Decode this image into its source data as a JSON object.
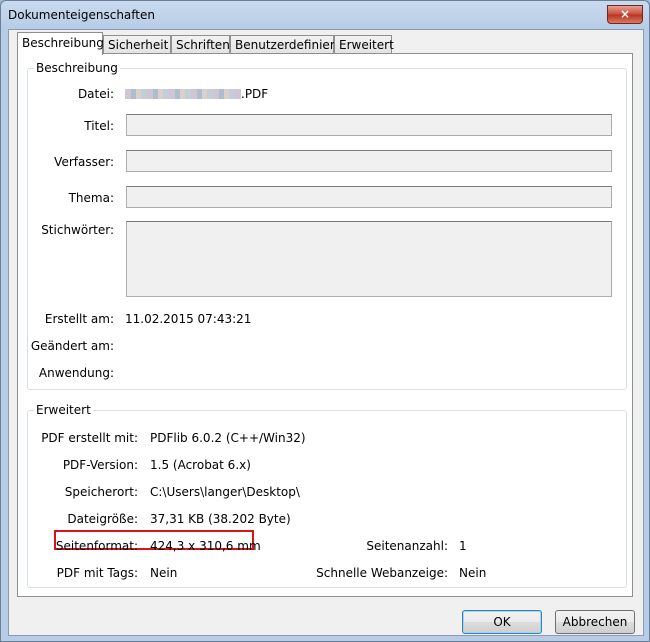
{
  "window": {
    "title": "Dokumenteigenschaften",
    "close_glyph": "×"
  },
  "tabs": [
    {
      "label": "Beschreibung"
    },
    {
      "label": "Sicherheit"
    },
    {
      "label": "Schriften"
    },
    {
      "label": "Benutzerdefiniert"
    },
    {
      "label": "Erweitert"
    }
  ],
  "beschreibung": {
    "group_title": "Beschreibung",
    "datei_label": "Datei:",
    "datei_value_suffix": ".PDF",
    "titel_label": "Titel:",
    "titel_value": "",
    "verfasser_label": "Verfasser:",
    "verfasser_value": "",
    "thema_label": "Thema:",
    "thema_value": "",
    "stichwoerter_label": "Stichwörter:",
    "stichwoerter_value": "",
    "erstellt_label": "Erstellt am:",
    "erstellt_value": "11.02.2015 07:43:21",
    "geaendert_label": "Geändert am:",
    "geaendert_value": "",
    "anwendung_label": "Anwendung:",
    "anwendung_value": ""
  },
  "erweitert": {
    "group_title": "Erweitert",
    "pdf_erstellt_label": "PDF erstellt mit:",
    "pdf_erstellt_value": "PDFlib 6.0.2 (C++/Win32)",
    "pdf_version_label": "PDF-Version:",
    "pdf_version_value": "1.5 (Acrobat 6.x)",
    "speicherort_label": "Speicherort:",
    "speicherort_value": "C:\\Users\\langer\\Desktop\\",
    "dateigroesse_label": "Dateigröße:",
    "dateigroesse_value": "37,31 KB (38.202 Byte)",
    "seitenformat_label": "Seitenformat:",
    "seitenformat_value": "424,3 x 310,6 mm",
    "seitenanzahl_label": "Seitenanzahl:",
    "seitenanzahl_value": "1",
    "pdf_tags_label": "PDF mit Tags:",
    "pdf_tags_value": "Nein",
    "webanzeige_label": "Schnelle Webanzeige:",
    "webanzeige_value": "Nein"
  },
  "buttons": {
    "ok": "OK",
    "cancel": "Abbrechen"
  },
  "colors": {
    "highlight": "#d4161c"
  }
}
